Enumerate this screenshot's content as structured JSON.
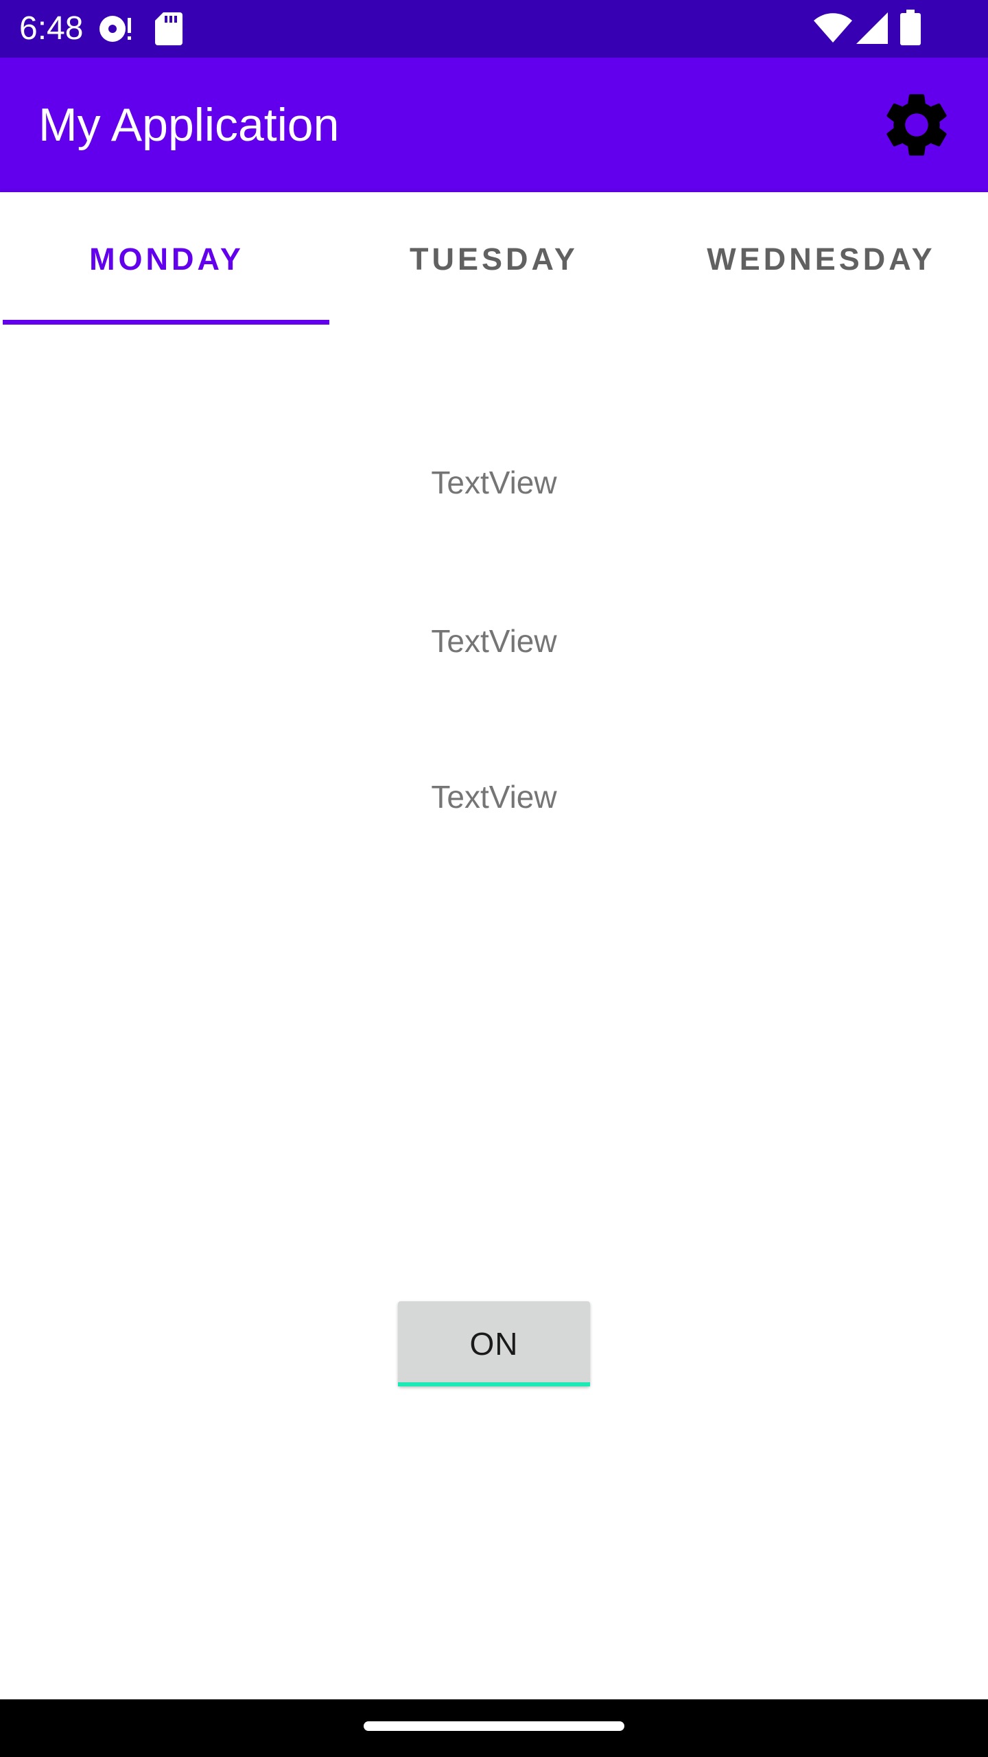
{
  "status_bar": {
    "time": "6:48",
    "icons": [
      "media-icon",
      "sd-card-icon",
      "wifi-icon",
      "signal-icon",
      "battery-icon"
    ],
    "background": "#3700b3"
  },
  "app_bar": {
    "title": "My Application",
    "action_icon": "gear-icon",
    "background": "#6200ee"
  },
  "tabs": {
    "items": [
      {
        "label": "MONDAY",
        "selected": true
      },
      {
        "label": "TUESDAY",
        "selected": false
      },
      {
        "label": "WEDNESDAY",
        "selected": false
      }
    ],
    "accent": "#6200ee"
  },
  "content": {
    "text_views": [
      "TextView",
      "TextView",
      "TextView"
    ],
    "toggle_button": {
      "label": "ON",
      "indicator_color": "#1de9b6"
    }
  }
}
